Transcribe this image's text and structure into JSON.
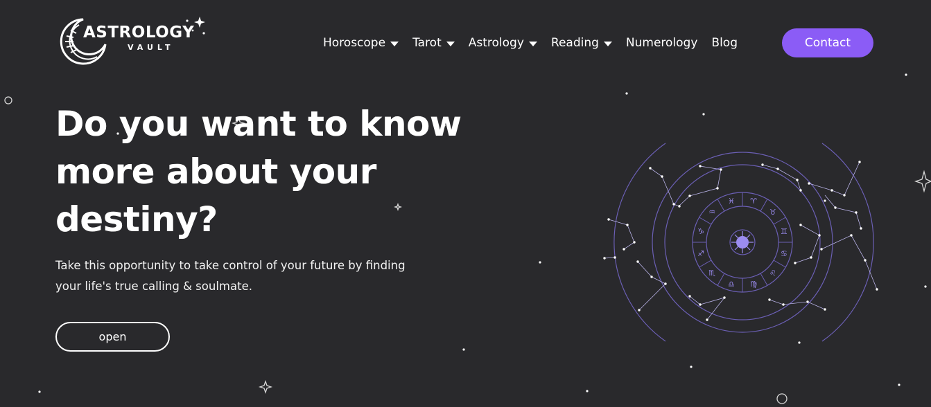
{
  "brand": {
    "name": "ASTROLOGY",
    "sub": "VAULT"
  },
  "nav": {
    "items": [
      {
        "label": "Horoscope",
        "dropdown": true
      },
      {
        "label": "Tarot",
        "dropdown": true
      },
      {
        "label": "Astrology",
        "dropdown": true
      },
      {
        "label": "Reading",
        "dropdown": true
      },
      {
        "label": "Numerology",
        "dropdown": false
      },
      {
        "label": "Blog",
        "dropdown": false
      }
    ],
    "contact_label": "Contact"
  },
  "hero": {
    "title": "Do you want to know more about your destiny?",
    "subtitle": "Take this opportunity to take control of your future by finding your life's true calling & soulmate.",
    "cta_label": "open"
  },
  "colors": {
    "background": "#29292c",
    "accent": "#8b5cf6",
    "text": "#ffffff",
    "wheel_line": "#6b5fb5",
    "zodiac_glyph": "#9b8cf0"
  },
  "icons": {
    "logo_mark": "crescent-moon-icon",
    "logo_sparkle": "sparkle-icon",
    "dropdown": "chevron-down-icon",
    "zodiac": "zodiac-wheel-icon"
  },
  "zodiac_wheel": {
    "signs": [
      "♈",
      "♉",
      "♊",
      "♋",
      "♌",
      "♍",
      "♎",
      "♏",
      "♐",
      "♑",
      "♒",
      "♓"
    ]
  }
}
